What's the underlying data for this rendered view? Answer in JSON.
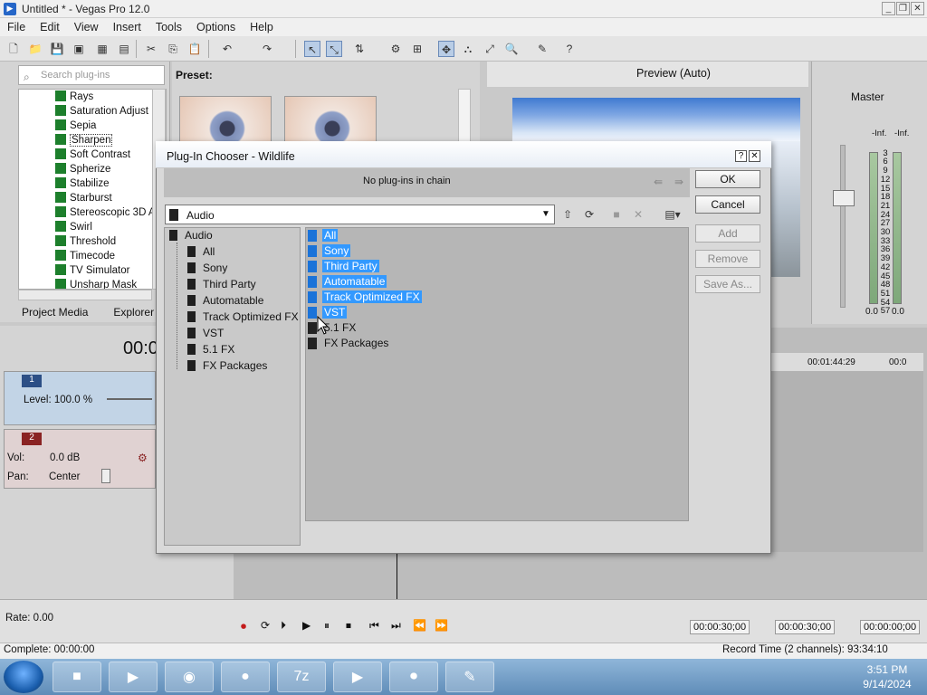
{
  "window": {
    "title": "Untitled * - Vegas Pro 12.0",
    "app_icon": "vegas-icon"
  },
  "menu": [
    "File",
    "Edit",
    "View",
    "Insert",
    "Tools",
    "Options",
    "Help"
  ],
  "fx_panel": {
    "search_placeholder": "Search plug-ins",
    "items": [
      "Rays",
      "Saturation Adjust",
      "Sepia",
      "Sharpen",
      "Soft Contrast",
      "Spherize",
      "Stabilize",
      "Starburst",
      "Stereoscopic 3D A",
      "Swirl",
      "Threshold",
      "Timecode",
      "TV Simulator",
      "Unsharp Mask"
    ],
    "selected_index": 3,
    "tabs": [
      "Project Media",
      "Explorer"
    ]
  },
  "preset": {
    "label": "Preset:"
  },
  "preview": {
    "label": "Preview (Auto)"
  },
  "mixer": {
    "label": "Master",
    "scale": [
      "-Inf.",
      "3",
      "6",
      "9",
      "12",
      "15",
      "18",
      "21",
      "24",
      "27",
      "30",
      "33",
      "36",
      "39",
      "42",
      "45",
      "48",
      "51",
      "54",
      "57"
    ],
    "bottom_values": [
      "0.0",
      "0.0"
    ],
    "top_values": [
      "-Inf.",
      "-Inf."
    ]
  },
  "tracks": {
    "timecode": "00:0",
    "track1": {
      "number": "1",
      "level": "Level: 100.0 %"
    },
    "track2": {
      "number": "2",
      "vol_label": "Vol:",
      "vol_value": "0.0 dB",
      "pan_label": "Pan:",
      "pan_value": "Center"
    }
  },
  "timeline": {
    "ruler": [
      "00:01:44:29",
      "00:0"
    ]
  },
  "transport": {
    "rate": "Rate: 0.00",
    "timecodes": [
      "00:00:30;00",
      "00:00:30;00",
      "00:00:00;00"
    ]
  },
  "status": {
    "complete": "Complete: 00:00:00",
    "record_time": "Record Time (2 channels): 93:34:10"
  },
  "taskbar": {
    "time": "3:51 PM",
    "date": "9/14/2024"
  },
  "dialog": {
    "title": "Plug-In Chooser - Wildlife",
    "chain_text": "No plug-ins in chain",
    "combo_value": "Audio",
    "buttons": {
      "ok": "OK",
      "cancel": "Cancel",
      "add": "Add",
      "remove": "Remove",
      "save_as": "Save As..."
    },
    "tree_root": "Audio",
    "tree_children": [
      "All",
      "Sony",
      "Third Party",
      "Automatable",
      "Track Optimized FX",
      "VST",
      "5.1 FX",
      "FX Packages"
    ],
    "list_items": [
      "All",
      "Sony",
      "Third Party",
      "Automatable",
      "Track Optimized FX",
      "VST",
      "5.1 FX",
      "FX Packages"
    ],
    "selected_count": 6
  }
}
